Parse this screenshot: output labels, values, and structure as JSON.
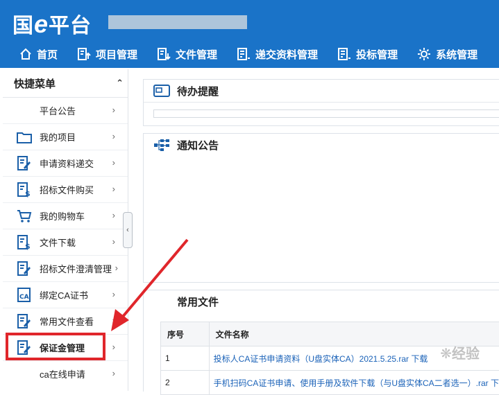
{
  "header": {
    "logo_prefix": "国",
    "logo_e": "e",
    "logo_suffix": "平台"
  },
  "nav": [
    {
      "label": "首页",
      "icon": "home-icon"
    },
    {
      "label": "项目管理",
      "icon": "doc-up-icon"
    },
    {
      "label": "文件管理",
      "icon": "doc-down-icon"
    },
    {
      "label": "递交资料管理",
      "icon": "doc-list-icon"
    },
    {
      "label": "投标管理",
      "icon": "doc-list-icon"
    },
    {
      "label": "系统管理",
      "icon": "gear-icon"
    }
  ],
  "sidebar": {
    "title": "快捷菜单",
    "items": [
      {
        "label": "平台公告",
        "icon": ""
      },
      {
        "label": "我的项目",
        "icon": "folder-icon"
      },
      {
        "label": "申请资料递交",
        "icon": "edit-doc-icon"
      },
      {
        "label": "招标文件购买",
        "icon": "money-doc-icon"
      },
      {
        "label": "我的购物车",
        "icon": "cart-icon"
      },
      {
        "label": "文件下载",
        "icon": "money-doc-icon"
      },
      {
        "label": "招标文件澄清管理",
        "icon": "edit-doc-icon"
      },
      {
        "label": "绑定CA证书",
        "icon": "ca-icon"
      },
      {
        "label": "常用文件查看",
        "icon": "edit-doc-icon"
      },
      {
        "label": "保证金管理",
        "icon": "edit-doc-icon"
      },
      {
        "label": "ca在线申请",
        "icon": ""
      }
    ]
  },
  "panels": {
    "todo_title": "待办提醒",
    "notice_title": "通知公告",
    "files_title": "常用文件"
  },
  "files_table": {
    "headers": [
      "序号",
      "文件名称"
    ],
    "rows": [
      {
        "no": "1",
        "name": "投标人CA证书申请资料（U盘实体CA）2021.5.25.rar 下载"
      },
      {
        "no": "2",
        "name": "手机扫码CA证书申请、使用手册及软件下载（与U盘实体CA二者选一）.rar 下"
      }
    ]
  },
  "watermark": "经验",
  "colors": {
    "header_bg": "#1a73c8",
    "highlight": "#e0262b",
    "link": "#1a62b8"
  }
}
